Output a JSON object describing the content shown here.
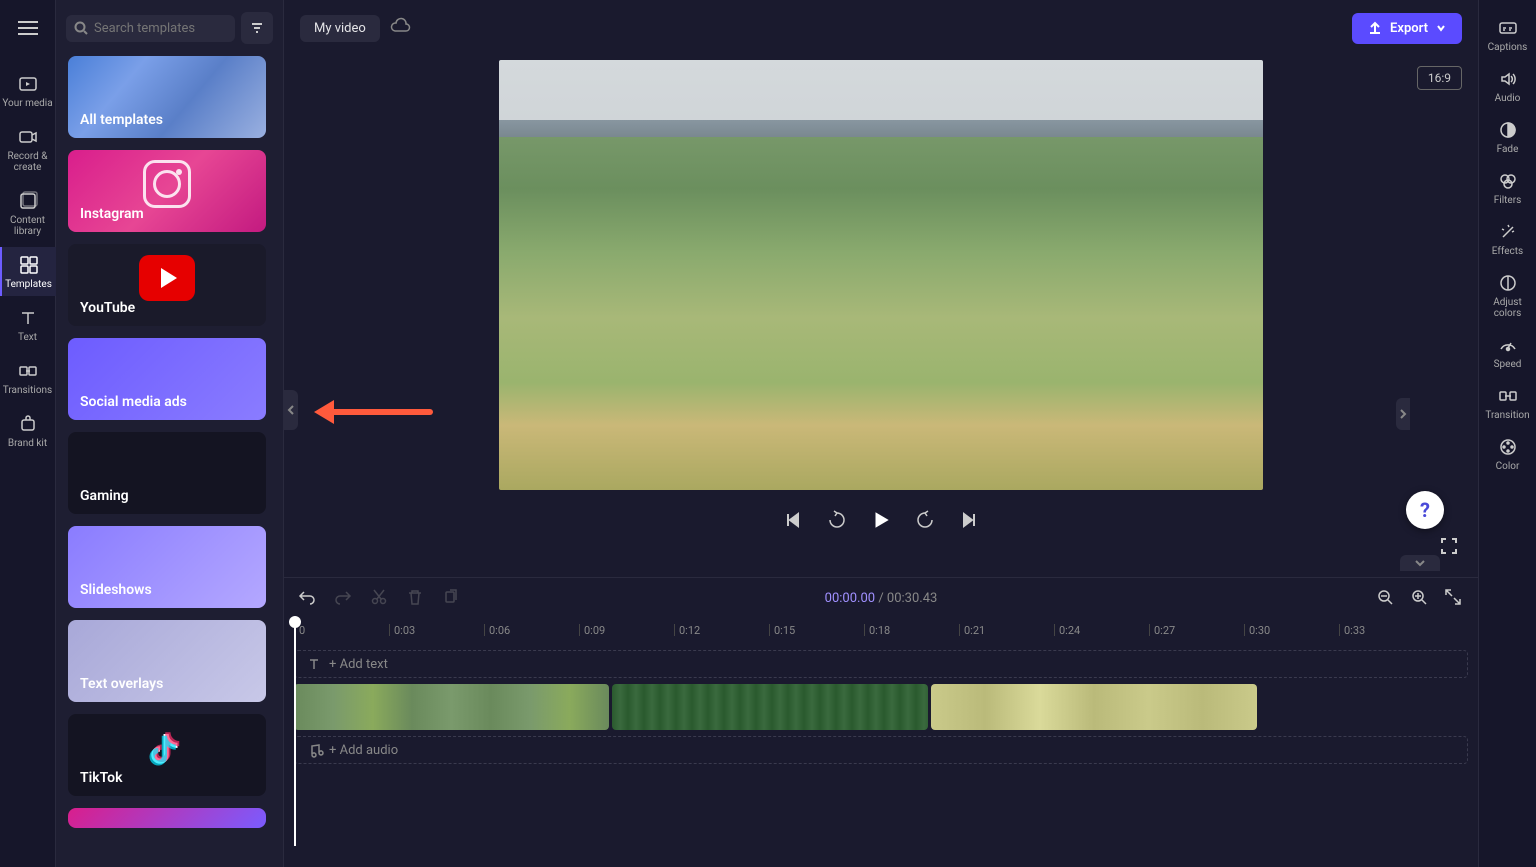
{
  "leftRail": {
    "items": [
      {
        "label": "Your media"
      },
      {
        "label": "Record & create"
      },
      {
        "label": "Content library"
      },
      {
        "label": "Templates"
      },
      {
        "label": "Text"
      },
      {
        "label": "Transitions"
      },
      {
        "label": "Brand kit"
      }
    ]
  },
  "panel": {
    "searchPlaceholder": "Search templates",
    "cards": [
      {
        "label": "All templates"
      },
      {
        "label": "Instagram"
      },
      {
        "label": "YouTube"
      },
      {
        "label": "Social media ads"
      },
      {
        "label": "Gaming"
      },
      {
        "label": "Slideshows"
      },
      {
        "label": "Text overlays"
      },
      {
        "label": "TikTok"
      }
    ]
  },
  "topbar": {
    "title": "My video",
    "export": "Export"
  },
  "preview": {
    "aspect": "16:9"
  },
  "timeline": {
    "current": "00:00.00",
    "duration": "00:30.43",
    "marks": [
      "0",
      "0:03",
      "0:06",
      "0:09",
      "0:12",
      "0:15",
      "0:18",
      "0:21",
      "0:24",
      "0:27",
      "0:30",
      "0:33"
    ],
    "addText": "+ Add text",
    "addAudio": "+ Add audio"
  },
  "rightRail": {
    "items": [
      {
        "label": "Captions"
      },
      {
        "label": "Audio"
      },
      {
        "label": "Fade"
      },
      {
        "label": "Filters"
      },
      {
        "label": "Effects"
      },
      {
        "label": "Adjust colors"
      },
      {
        "label": "Speed"
      },
      {
        "label": "Transition"
      },
      {
        "label": "Color"
      }
    ]
  },
  "icons": {
    "hamburger": "hamburger",
    "search": "search",
    "help": "?"
  }
}
